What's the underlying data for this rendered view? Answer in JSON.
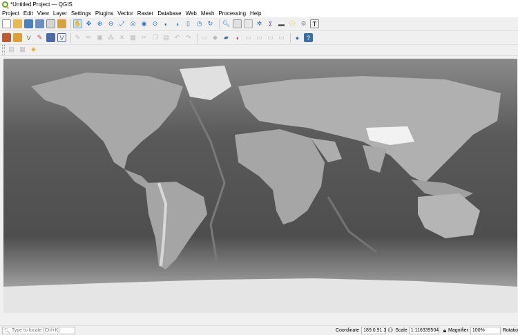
{
  "window": {
    "title": "*Untitled Project — QGIS"
  },
  "menu": [
    "Project",
    "Edit",
    "View",
    "Layer",
    "Settings",
    "Plugins",
    "Vector",
    "Raster",
    "Database",
    "Web",
    "Mesh",
    "Processing",
    "Help"
  ],
  "toolbar1_icons": [
    "new-project-icon",
    "open-project-icon",
    "save-project-icon",
    "save-as-icon",
    "print-layout-icon",
    "style-manager-icon",
    "pan-icon",
    "pan-to-selection-icon",
    "zoom-in-icon",
    "zoom-out-icon",
    "zoom-full-icon",
    "zoom-selection-icon",
    "zoom-layer-icon",
    "zoom-native-icon",
    "zoom-last-icon",
    "zoom-next-icon",
    "new-bookmark-icon",
    "show-bookmarks-icon",
    "refresh-icon",
    "identify-icon",
    "attribute-table-icon",
    "field-calculator-icon",
    "settings-icon",
    "statistics-icon",
    "measure-icon",
    "annotation-icon",
    "label-icon",
    "text-icon"
  ],
  "toolbar2_icons": [
    "data-source-manager-icon",
    "new-geopackage-icon",
    "new-shapefile-icon",
    "new-spatialite-icon",
    "new-memory-layer-icon",
    "new-virtual-layer-icon",
    "current-edits-icon",
    "toggle-editing-icon",
    "save-edits-icon",
    "digitize-icon",
    "vertex-tool-icon",
    "delete-icon",
    "cut-icon",
    "copy-icon",
    "paste-icon",
    "undo-icon",
    "redo-icon",
    "label-tool-1-icon",
    "label-tool-2-icon",
    "label-pin-icon",
    "label-show-icon",
    "label-move-icon",
    "label-rotate-icon",
    "label-change-icon",
    "label-highlight-icon",
    "python-console-icon",
    "help-icon"
  ],
  "toolbar3_icons": [
    "select-features-icon",
    "select-value-icon",
    "deselect-icon"
  ],
  "status": {
    "locate_placeholder": "Type to locate (Ctrl+K)",
    "coordinate_label": "Coordinate",
    "coordinate_value": "189.0,91.3",
    "scale_label": "Scale",
    "scale_value": "1:116339504",
    "magnifier_label": "Magnifier",
    "magnifier_value": "100%",
    "rotation_label": "Rotatio"
  }
}
